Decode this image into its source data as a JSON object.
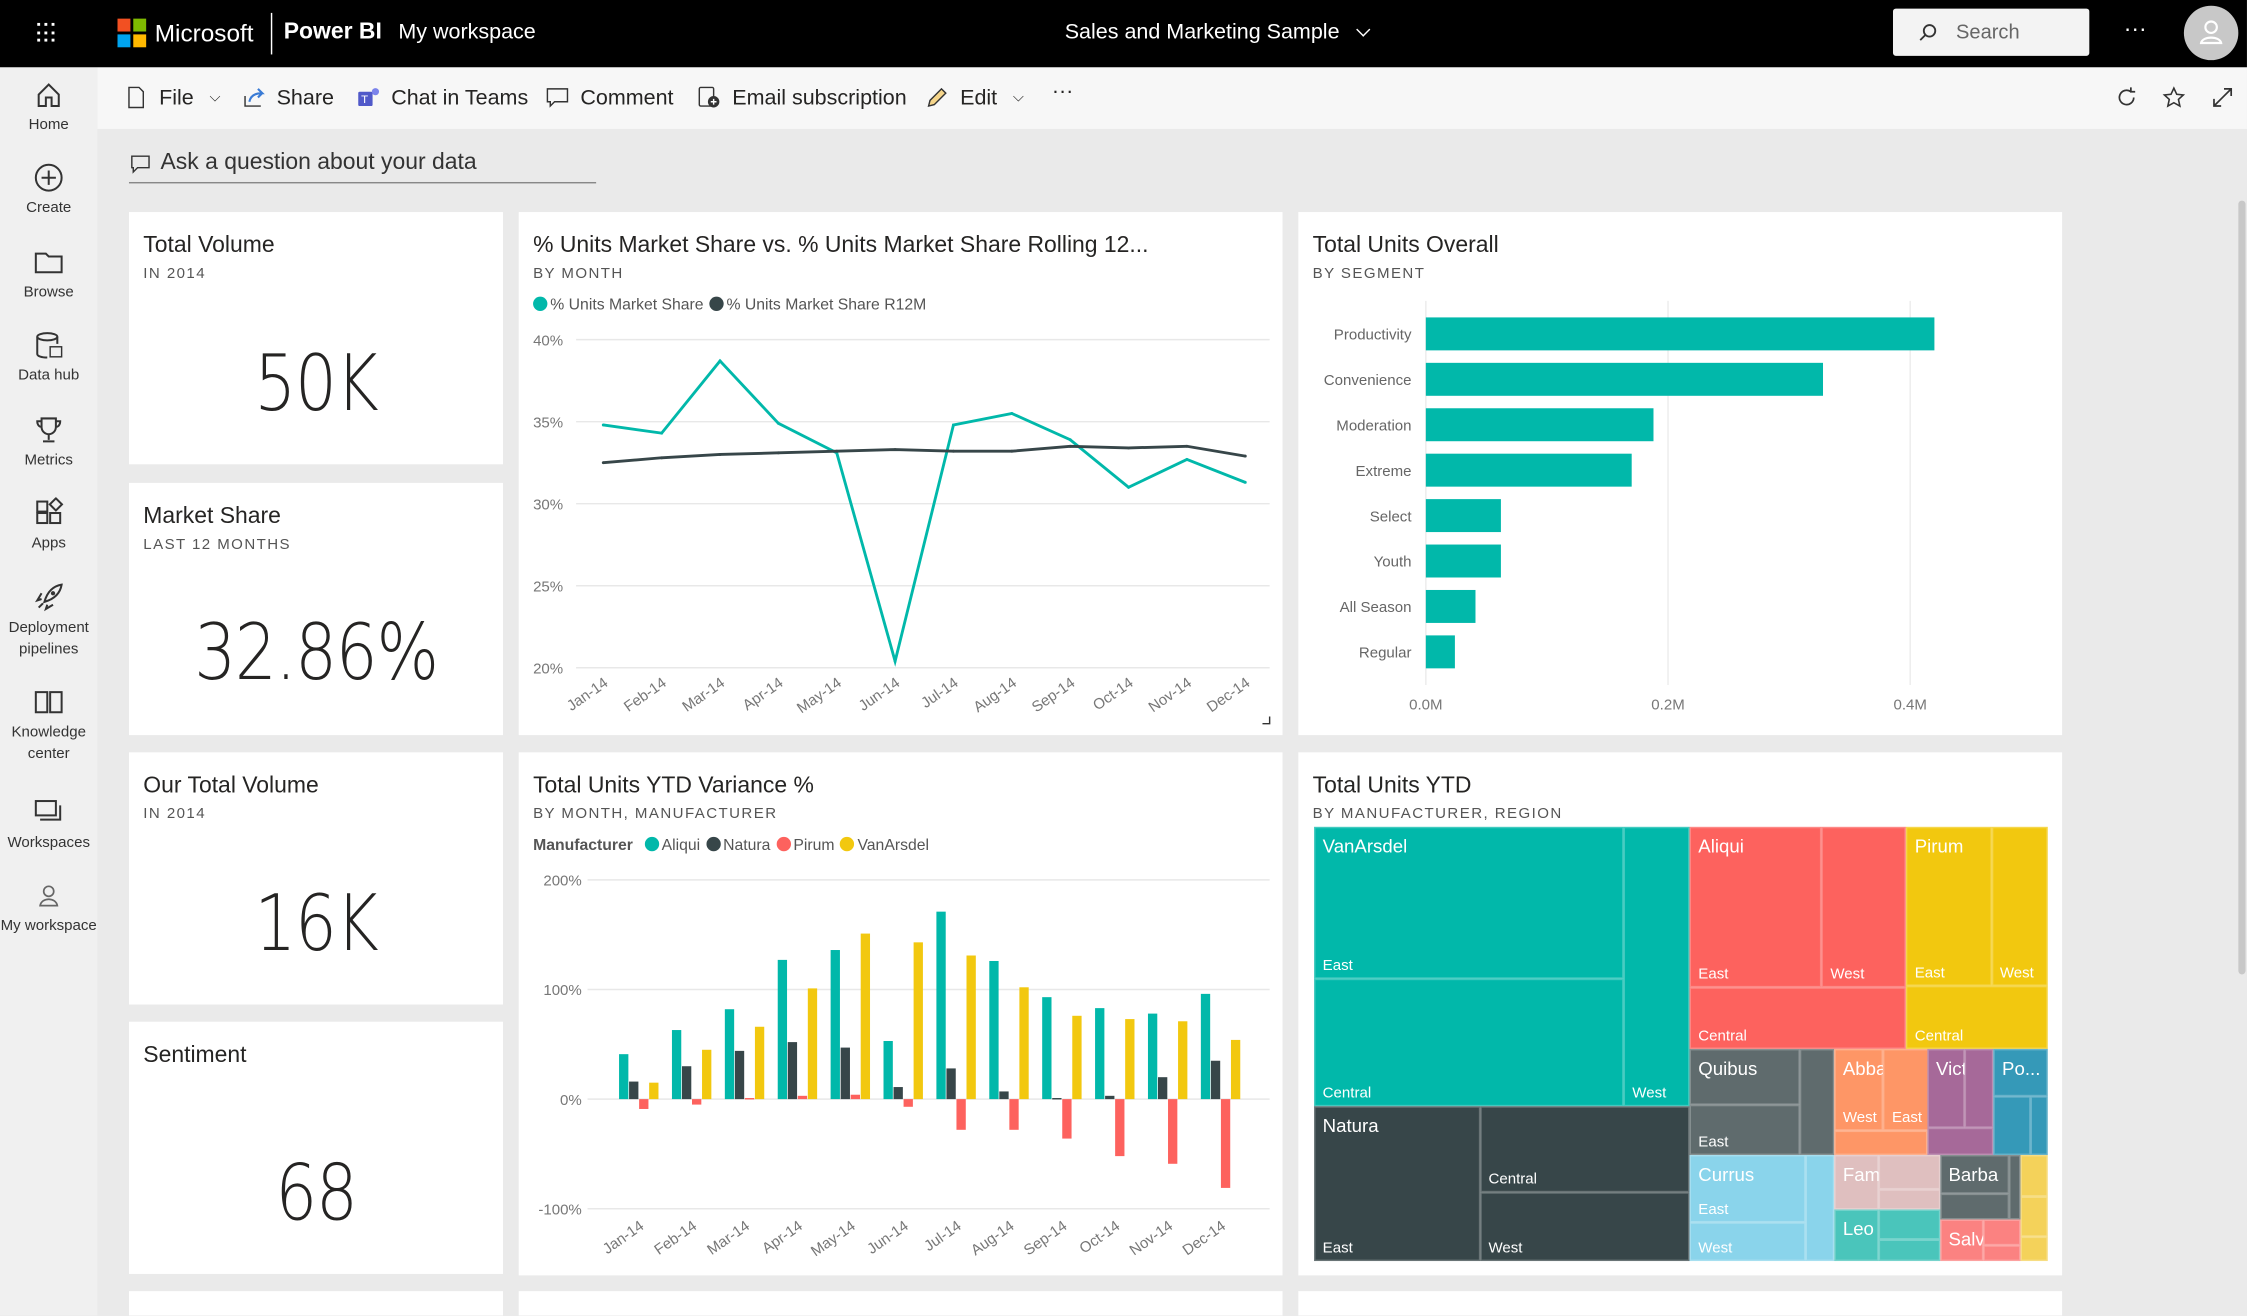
{
  "topbar": {
    "brand": "Microsoft",
    "product": "Power BI",
    "workspace": "My workspace",
    "report_title": "Sales and Marketing Sample",
    "search_placeholder": "Search",
    "more": "···"
  },
  "sidebar": {
    "items": [
      {
        "label": "Home",
        "icon": "home-icon"
      },
      {
        "label": "Create",
        "icon": "plus-circle-icon"
      },
      {
        "label": "Browse",
        "icon": "folder-icon"
      },
      {
        "label": "Data hub",
        "icon": "database-icon"
      },
      {
        "label": "Metrics",
        "icon": "trophy-icon"
      },
      {
        "label": "Apps",
        "icon": "apps-icon"
      },
      {
        "label": "Deployment pipelines",
        "icon": "rocket-icon"
      },
      {
        "label": "Knowledge center",
        "icon": "book-icon"
      },
      {
        "label": "Workspaces",
        "icon": "workspaces-icon"
      },
      {
        "label": "My workspace",
        "icon": "person-icon"
      }
    ]
  },
  "toolbar": {
    "file": "File",
    "share": "Share",
    "teams": "Chat in Teams",
    "comment": "Comment",
    "email": "Email subscription",
    "edit": "Edit",
    "more": "···"
  },
  "qa": {
    "placeholder": "Ask a question about your data"
  },
  "kpis": [
    {
      "title": "Total Volume",
      "subtitle": "IN 2014",
      "value": "50K"
    },
    {
      "title": "Market Share",
      "subtitle": "LAST 12 MONTHS",
      "value": "32.86%"
    },
    {
      "title": "Our Total Volume",
      "subtitle": "IN 2014",
      "value": "16K"
    },
    {
      "title": "Sentiment",
      "subtitle": "",
      "value": "68"
    }
  ],
  "colors": {
    "teal": "#01b8aa",
    "dark": "#374649",
    "red": "#fd625e",
    "yellow": "#f2c80f"
  },
  "chart_data": [
    {
      "type": "line",
      "title": "% Units Market Share vs. % Units Market Share Rolling 12...",
      "subtitle": "BY MONTH",
      "categories": [
        "Jan-14",
        "Feb-14",
        "Mar-14",
        "Apr-14",
        "May-14",
        "Jun-14",
        "Jul-14",
        "Aug-14",
        "Sep-14",
        "Oct-14",
        "Nov-14",
        "Dec-14"
      ],
      "yticks": [
        "20%",
        "25%",
        "30%",
        "35%",
        "40%"
      ],
      "ylim": [
        20,
        40
      ],
      "grid": true,
      "legend": "top-left",
      "series": [
        {
          "name": "% Units Market Share",
          "color": "#01b8aa",
          "values": [
            34.8,
            34.3,
            38.7,
            34.9,
            33.1,
            20.4,
            34.8,
            35.5,
            33.9,
            31.0,
            32.7,
            31.3
          ]
        },
        {
          "name": "% Units Market Share R12M",
          "color": "#374649",
          "values": [
            32.5,
            32.8,
            33.0,
            33.1,
            33.2,
            33.3,
            33.2,
            33.2,
            33.5,
            33.4,
            33.5,
            32.9
          ]
        }
      ]
    },
    {
      "type": "bar",
      "orientation": "horizontal",
      "title": "Total Units Overall",
      "subtitle": "BY SEGMENT",
      "categories": [
        "Productivity",
        "Convenience",
        "Moderation",
        "Extreme",
        "Select",
        "Youth",
        "All Season",
        "Regular"
      ],
      "values": [
        0.42,
        0.328,
        0.188,
        0.17,
        0.062,
        0.062,
        0.041,
        0.024
      ],
      "unit": "M",
      "xticks": [
        "0.0M",
        "0.2M",
        "0.4M"
      ],
      "xlim": [
        0,
        0.4
      ],
      "color": "#01b8aa",
      "grid": true
    },
    {
      "type": "bar",
      "title": "Total Units YTD Variance %",
      "subtitle": "BY MONTH, MANUFACTURER",
      "legend_title": "Manufacturer",
      "legend": "top-left",
      "categories": [
        "Jan-14",
        "Feb-14",
        "Mar-14",
        "Apr-14",
        "May-14",
        "Jun-14",
        "Jul-14",
        "Aug-14",
        "Sep-14",
        "Oct-14",
        "Nov-14",
        "Dec-14"
      ],
      "yticks": [
        "-100%",
        "0%",
        "100%",
        "200%"
      ],
      "ylim": [
        -100,
        200
      ],
      "grid": true,
      "series": [
        {
          "name": "Aliqui",
          "color": "#01b8aa",
          "values": [
            41,
            63,
            82,
            127,
            136,
            53,
            171,
            126,
            93,
            83,
            78,
            96
          ]
        },
        {
          "name": "Natura",
          "color": "#374649",
          "values": [
            16,
            30,
            44,
            52,
            47,
            11,
            28,
            7,
            1,
            3,
            20,
            35
          ]
        },
        {
          "name": "Pirum",
          "color": "#fd625e",
          "values": [
            -9,
            -5,
            1,
            3,
            4,
            -7,
            -28,
            -28,
            -36,
            -52,
            -59,
            -81
          ]
        },
        {
          "name": "VanArsdel",
          "color": "#f2c80f",
          "values": [
            15,
            45,
            66,
            101,
            151,
            143,
            131,
            102,
            76,
            73,
            71,
            54
          ]
        }
      ]
    },
    {
      "type": "treemap",
      "title": "Total Units YTD",
      "subtitle": "BY MANUFACTURER, REGION",
      "nodes": [
        {
          "name": "VanArsdel",
          "color": "#01b8aa",
          "regions": [
            "East",
            "Central",
            "West"
          ]
        },
        {
          "name": "Natura",
          "color": "#374649",
          "regions": [
            "East",
            "Central",
            "West"
          ]
        },
        {
          "name": "Aliqui",
          "color": "#fd625e",
          "regions": [
            "East",
            "West",
            "Central"
          ]
        },
        {
          "name": "Pirum",
          "color": "#f2c80f",
          "regions": [
            "East",
            "West",
            "Central"
          ]
        },
        {
          "name": "Quibus",
          "color": "#5f6b6d",
          "regions": [
            "East"
          ]
        },
        {
          "name": "Abbas",
          "color": "#fe9666",
          "regions": [
            "West",
            "East"
          ]
        },
        {
          "name": "Vict...",
          "color": "#a66999",
          "regions": []
        },
        {
          "name": "Po...",
          "color": "#3599b8",
          "regions": []
        },
        {
          "name": "Currus",
          "color": "#8ad4eb",
          "regions": [
            "East",
            "West"
          ]
        },
        {
          "name": "Fama",
          "color": "#dfbfbf",
          "regions": []
        },
        {
          "name": "Leo",
          "color": "#4ac5bb",
          "regions": []
        },
        {
          "name": "Barba",
          "color": "#5f6b6d",
          "regions": []
        },
        {
          "name": "Salvus",
          "color": "#fb8281",
          "regions": []
        },
        {
          "name": "",
          "color": "#f4d25a",
          "regions": []
        }
      ]
    }
  ]
}
